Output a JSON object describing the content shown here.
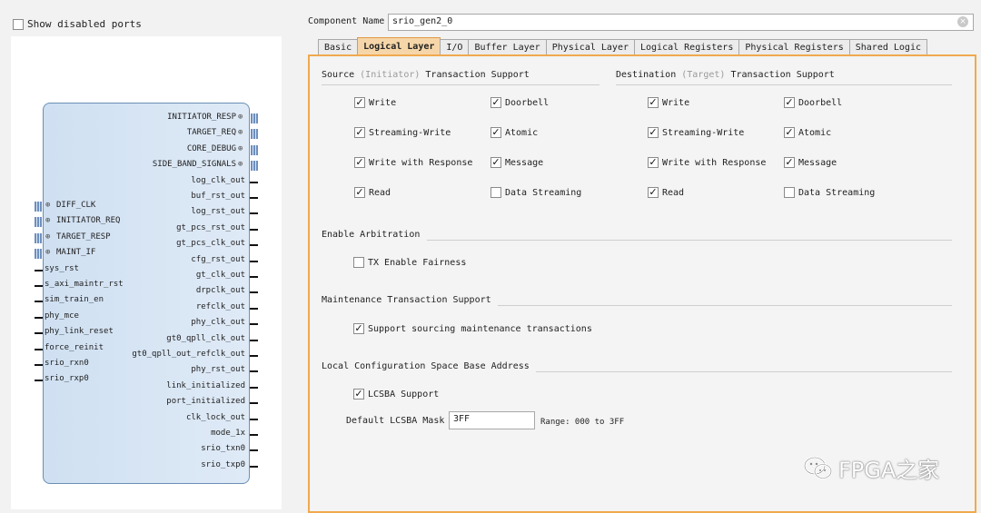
{
  "left": {
    "show_disabled_label": "Show disabled ports",
    "right_ports": [
      {
        "label": "INITIATOR_RESP",
        "type": "bus",
        "plus": true
      },
      {
        "label": "TARGET_REQ",
        "type": "bus",
        "plus": true
      },
      {
        "label": "CORE_DEBUG",
        "type": "bus",
        "plus": true
      },
      {
        "label": "SIDE_BAND_SIGNALS",
        "type": "bus",
        "plus": true
      },
      {
        "label": "log_clk_out",
        "type": "wire"
      },
      {
        "label": "buf_rst_out",
        "type": "wire"
      },
      {
        "label": "log_rst_out",
        "type": "wire"
      },
      {
        "label": "gt_pcs_rst_out",
        "type": "wire"
      },
      {
        "label": "gt_pcs_clk_out",
        "type": "wire"
      },
      {
        "label": "cfg_rst_out",
        "type": "wire"
      },
      {
        "label": "gt_clk_out",
        "type": "wire"
      },
      {
        "label": "drpclk_out",
        "type": "wire"
      },
      {
        "label": "refclk_out",
        "type": "wire"
      },
      {
        "label": "phy_clk_out",
        "type": "wire"
      },
      {
        "label": "gt0_qpll_clk_out",
        "type": "wire"
      },
      {
        "label": "gt0_qpll_out_refclk_out",
        "type": "wire"
      },
      {
        "label": "phy_rst_out",
        "type": "wire"
      },
      {
        "label": "link_initialized",
        "type": "wire"
      },
      {
        "label": "port_initialized",
        "type": "wire"
      },
      {
        "label": "clk_lock_out",
        "type": "wire"
      },
      {
        "label": "mode_1x",
        "type": "wire"
      },
      {
        "label": "srio_txn0",
        "type": "wire"
      },
      {
        "label": "srio_txp0",
        "type": "wire"
      }
    ],
    "left_ports": [
      {
        "label": "DIFF_CLK",
        "type": "bus",
        "plus": true
      },
      {
        "label": "INITIATOR_REQ",
        "type": "bus",
        "plus": true
      },
      {
        "label": "TARGET_RESP",
        "type": "bus",
        "plus": true
      },
      {
        "label": "MAINT_IF",
        "type": "bus",
        "plus": true
      },
      {
        "label": "sys_rst",
        "type": "wire"
      },
      {
        "label": "s_axi_maintr_rst",
        "type": "wire"
      },
      {
        "label": "sim_train_en",
        "type": "wire"
      },
      {
        "label": "phy_mce",
        "type": "wire"
      },
      {
        "label": "phy_link_reset",
        "type": "wire"
      },
      {
        "label": "force_reinit",
        "type": "wire"
      },
      {
        "label": "srio_rxn0",
        "type": "wire"
      },
      {
        "label": "srio_rxp0",
        "type": "wire"
      }
    ]
  },
  "component": {
    "label": "Component Name",
    "value": "srio_gen2_0",
    "clear_icon": "clear-icon"
  },
  "tabs": [
    {
      "label": "Basic",
      "active": false
    },
    {
      "label": "Logical Layer",
      "active": true
    },
    {
      "label": "I/O",
      "active": false
    },
    {
      "label": "Buffer Layer",
      "active": false
    },
    {
      "label": "Physical Layer",
      "active": false
    },
    {
      "label": "Logical Registers",
      "active": false
    },
    {
      "label": "Physical Registers",
      "active": false
    },
    {
      "label": "Shared Logic",
      "active": false
    }
  ],
  "source": {
    "title_a": "Source ",
    "title_b": "(Initiator)",
    "title_c": " Transaction Support",
    "options": [
      {
        "label": "Write",
        "checked": true
      },
      {
        "label": "Doorbell",
        "checked": true
      },
      {
        "label": "Streaming-Write",
        "checked": true
      },
      {
        "label": "Atomic",
        "checked": true
      },
      {
        "label": "Write with Response",
        "checked": true
      },
      {
        "label": "Message",
        "checked": true
      },
      {
        "label": "Read",
        "checked": true
      },
      {
        "label": "Data Streaming",
        "checked": false
      }
    ]
  },
  "destination": {
    "title_a": "Destination ",
    "title_b": "(Target)",
    "title_c": " Transaction Support",
    "options": [
      {
        "label": "Write",
        "checked": true
      },
      {
        "label": "Doorbell",
        "checked": true
      },
      {
        "label": "Streaming-Write",
        "checked": true
      },
      {
        "label": "Atomic",
        "checked": true
      },
      {
        "label": "Write with Response",
        "checked": true
      },
      {
        "label": "Message",
        "checked": true
      },
      {
        "label": "Read",
        "checked": true
      },
      {
        "label": "Data Streaming",
        "checked": false
      }
    ]
  },
  "arbitration": {
    "title": "Enable Arbitration",
    "option": {
      "label": "TX Enable Fairness",
      "checked": false
    }
  },
  "maintenance": {
    "title": "Maintenance Transaction Support",
    "option": {
      "label": "Support sourcing maintenance transactions",
      "checked": true
    }
  },
  "lcsba": {
    "title": "Local Configuration Space Base Address",
    "option": {
      "label": "LCSBA Support",
      "checked": true
    },
    "mask_label": "Default LCSBA Mask",
    "mask_value": "3FF",
    "range": "Range: 000 to 3FF"
  },
  "watermark": {
    "text": "FPGA之家",
    "icon": "chat-bubbles-icon"
  }
}
